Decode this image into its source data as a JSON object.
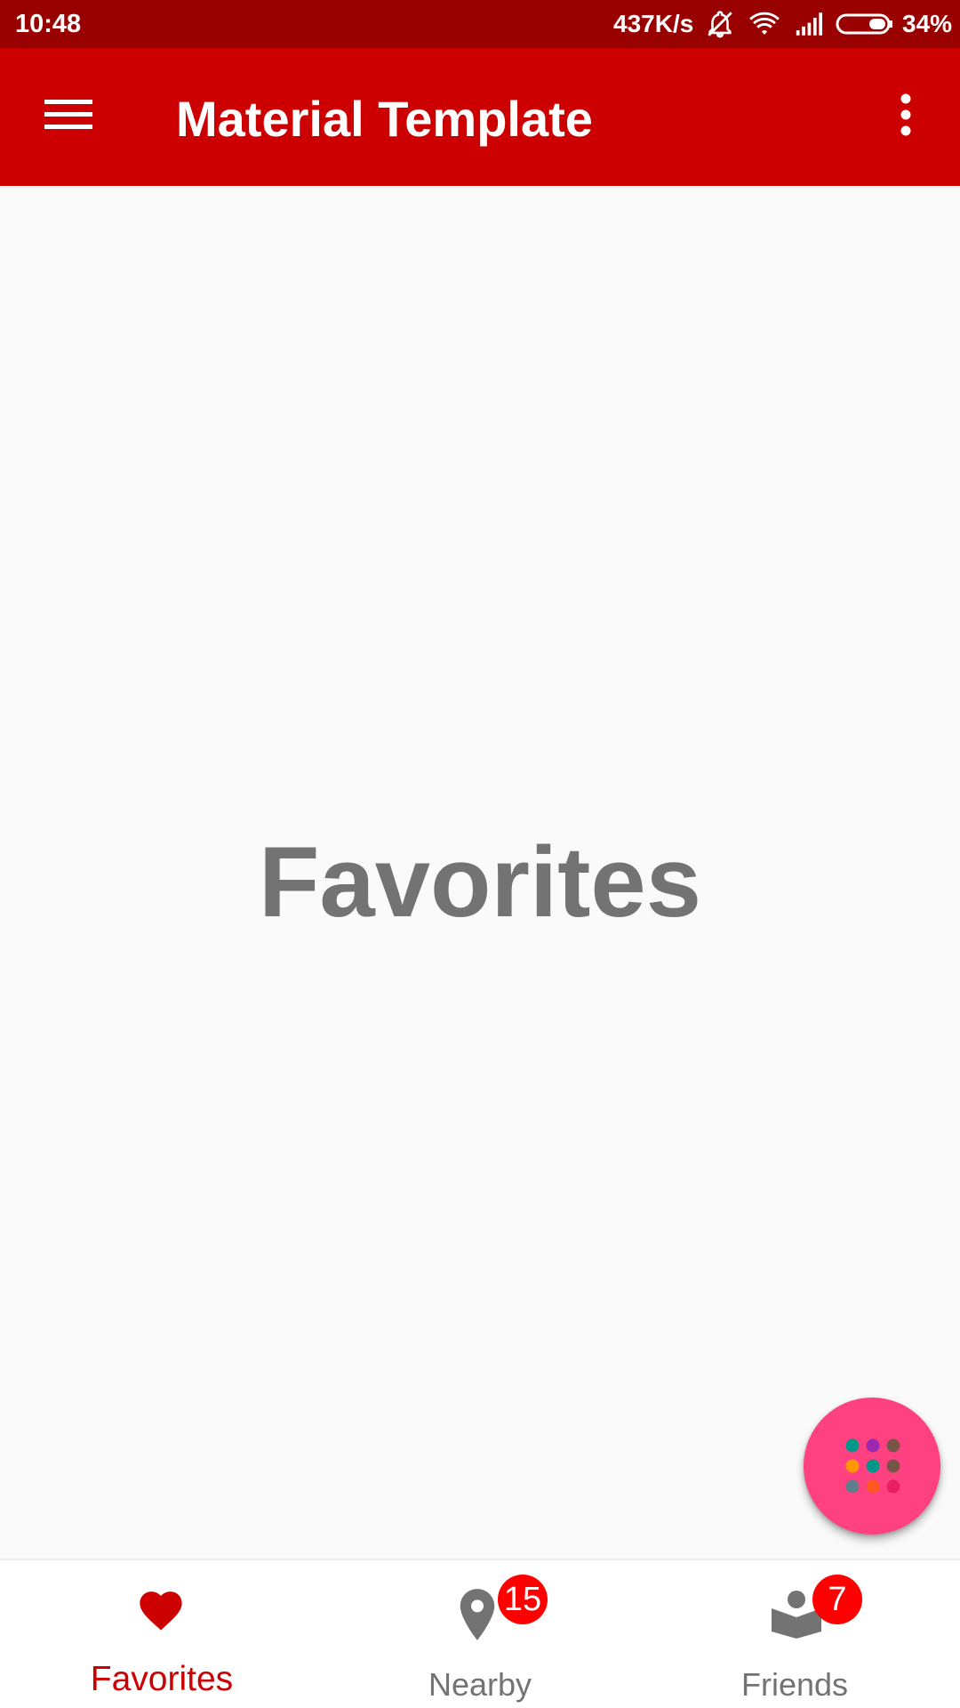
{
  "status_bar": {
    "time": "10:48",
    "network_speed": "437K/s",
    "battery_percent": "34%",
    "icons": [
      "mute-alarm-icon",
      "wifi-icon",
      "signal-icon",
      "battery-icon"
    ]
  },
  "app_bar": {
    "title": "Material Template",
    "menu_icon": "hamburger-menu-icon",
    "overflow_icon": "more-vert-icon",
    "color": "#cc0000"
  },
  "main": {
    "heading": "Favorites"
  },
  "fab": {
    "icon": "dots-grid-icon",
    "color": "#ff4081"
  },
  "bottom_nav": {
    "items": [
      {
        "label": "Favorites",
        "icon": "heart-icon",
        "active": true
      },
      {
        "label": "Nearby",
        "icon": "location-pin-icon",
        "badge": "15",
        "active": false
      },
      {
        "label": "Friends",
        "icon": "friends-icon",
        "badge": "7",
        "active": false
      }
    ],
    "active_color": "#cc0000",
    "inactive_color": "#737373",
    "badge_color": "#ff0000"
  }
}
